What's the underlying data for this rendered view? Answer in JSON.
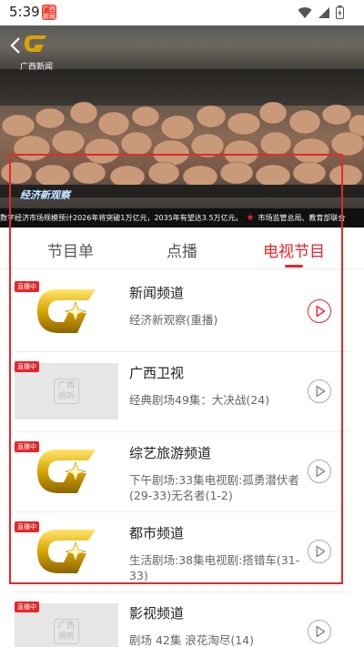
{
  "status_bar": {
    "time": "5:39",
    "app_icon_text": "广西新闻",
    "icons": [
      "wifi-icon",
      "signal-icon",
      "battery-icon"
    ]
  },
  "video": {
    "logo_text": "广西新闻",
    "caption": "经济新观察",
    "ticker_text_1": "数字经济市场规模预计2026年将突破1万亿元，2035年有望达3.5万亿元。",
    "ticker_text_2": "市场监管总局、教育部联合"
  },
  "tabs": [
    {
      "label": "节目单",
      "active": false
    },
    {
      "label": "点播",
      "active": false
    },
    {
      "label": "电视节目",
      "active": true
    }
  ],
  "live_badge": "直播中",
  "placeholder_logo_text": [
    "广西",
    "视听"
  ],
  "channels": [
    {
      "name": "新闻频道",
      "program": "经济新观察(重播)",
      "thumb": "gold-logo",
      "playing": true
    },
    {
      "name": "广西卫视",
      "program": "经典剧场49集：大决战(24)",
      "thumb": "placeholder",
      "playing": false
    },
    {
      "name": "综艺旅游频道",
      "program": "下午剧场:33集电视剧:孤勇潜伏者(29-33)无名者(1-2)",
      "thumb": "gold-logo",
      "playing": false
    },
    {
      "name": "都市频道",
      "program": "生活剧场:38集电视剧:搭错车(31-33)",
      "thumb": "gold-logo",
      "playing": false
    },
    {
      "name": "影视频道",
      "program": "剧场 42集 浪花淘尽(14)",
      "thumb": "placeholder",
      "playing": false
    }
  ],
  "colors": {
    "accent": "#e8252a",
    "highlight_box": "#e02b2b",
    "logo_gold": "#d8a400"
  }
}
